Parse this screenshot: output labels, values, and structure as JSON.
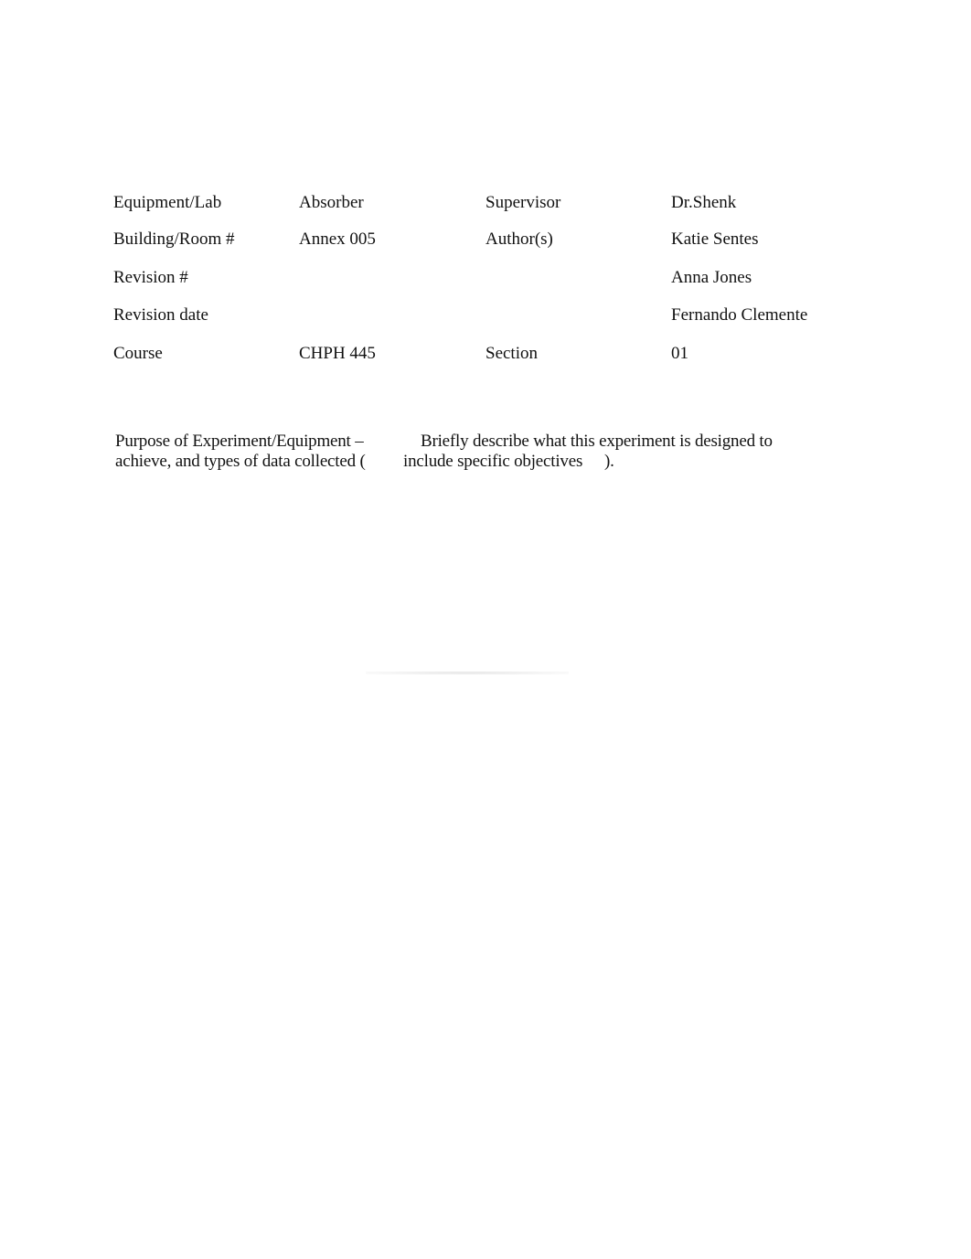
{
  "info_table": {
    "rows": [
      {
        "label": "Equipment/Lab",
        "value": "Absorber",
        "label2": "Supervisor",
        "value2": "Dr.Shenk"
      },
      {
        "label": "Building/Room #",
        "value": "Annex 005",
        "label2": "Author(s)",
        "value2": "Katie Sentes"
      },
      {
        "label": "Revision #",
        "value": "",
        "label2": "",
        "value2": "Anna Jones"
      },
      {
        "label": "Revision date",
        "value": "",
        "label2": "",
        "value2": "Fernando Clemente"
      },
      {
        "label": "Course",
        "value": "CHPH 445",
        "label2": "Section",
        "value2": "01"
      }
    ]
  },
  "purpose": {
    "line1_left": "Purpose of Experiment/Equipment –",
    "line1_right": "Briefly describe what this experiment is designed to",
    "line2_left": "achieve, and types of data collected (",
    "line2_right": "include specific objectives",
    "line2_end": ")."
  }
}
